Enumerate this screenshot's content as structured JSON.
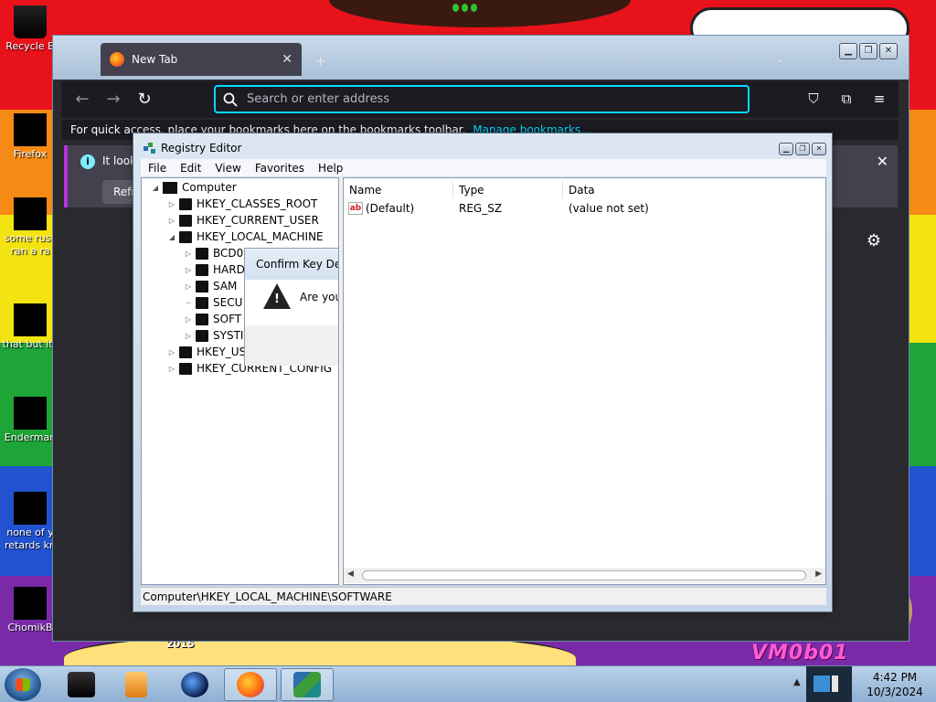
{
  "desktop": {
    "icons": [
      {
        "label": "Recycle B",
        "label2": ""
      },
      {
        "label": "Firefox",
        "label2": ""
      },
      {
        "label": "some russ",
        "label2": "ran a ra"
      },
      {
        "label": "that but its",
        "label2": ""
      },
      {
        "label": "Enderman",
        "label2": ""
      },
      {
        "label": "none of y",
        "label2": "retards kn"
      },
      {
        "label": "ChomikB",
        "label2": ""
      }
    ],
    "wallpaper_text": "2015",
    "watermark": "VM0b01"
  },
  "firefox": {
    "tab_title": "New Tab",
    "tab_close": "✕",
    "new_tab": "+",
    "tab_list": "⌄",
    "address_placeholder": "Search or enter address",
    "bookmarks_text": "For quick access, place your bookmarks here on the bookmarks toolbar.",
    "manage_bookmarks": "Manage bookmarks…",
    "notice_text": "It look",
    "notice_button": "Refr",
    "close_glyph": "✕"
  },
  "regedit": {
    "title": "Registry Editor",
    "menu": [
      "File",
      "Edit",
      "View",
      "Favorites",
      "Help"
    ],
    "tree": {
      "root": "Computer",
      "hives": [
        "HKEY_CLASSES_ROOT",
        "HKEY_CURRENT_USER",
        "HKEY_LOCAL_MACHINE",
        "HKEY_US",
        "HKEY_CURRENT_CONFIG"
      ],
      "hklm_children": [
        "BCD0",
        "HARD",
        "SAM",
        "SECU",
        "SOFT",
        "SYSTI"
      ]
    },
    "columns": [
      "Name",
      "Type",
      "Data"
    ],
    "rows": [
      {
        "name": "(Default)",
        "type": "REG_SZ",
        "data": "(value not set)"
      }
    ],
    "status_path": "Computer\\HKEY_LOCAL_MACHINE\\SOFTWARE",
    "dialog": {
      "title": "Confirm Key Dele",
      "question": "Are you"
    }
  },
  "taskbar": {
    "time": "4:42 PM",
    "date": "10/3/2024"
  },
  "colors": {
    "accent_focus": "#00ddff",
    "firefox_bg": "#2a2a2e",
    "notice_accent": "#b833e1"
  }
}
